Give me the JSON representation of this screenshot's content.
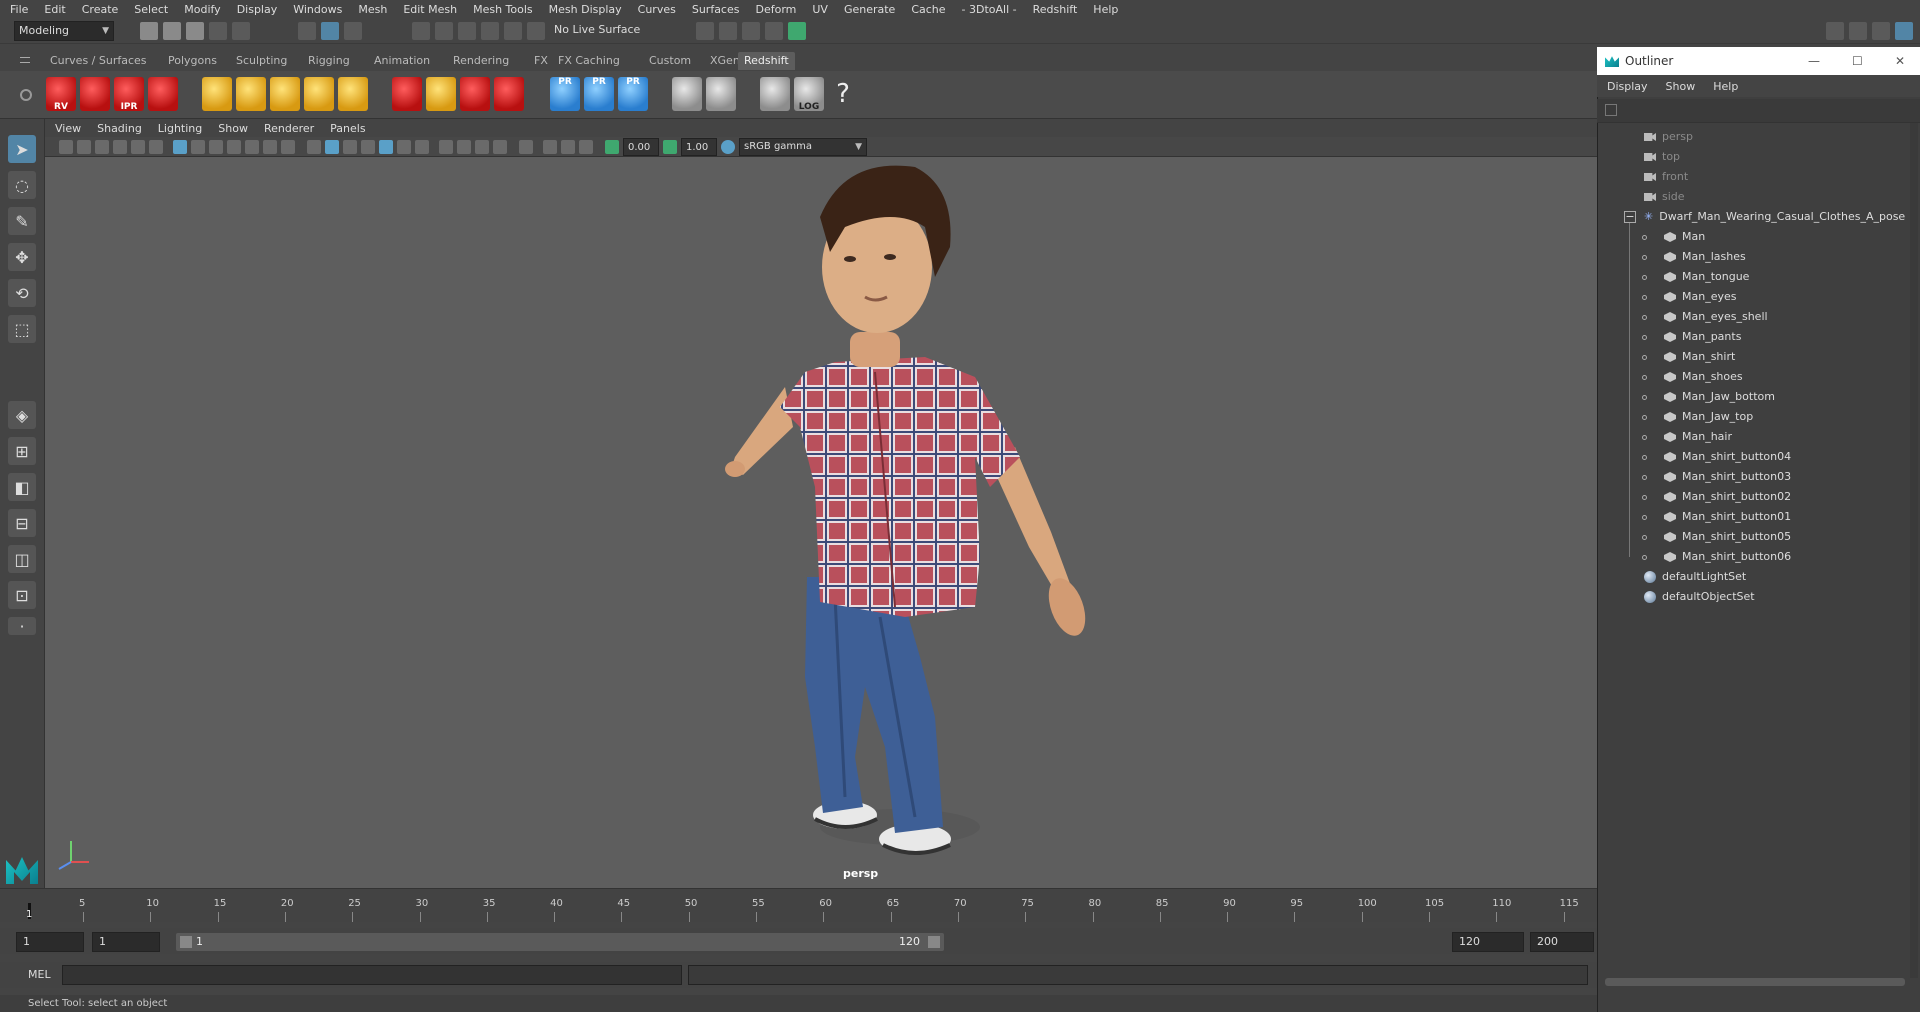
{
  "menubar": {
    "items": [
      "File",
      "Edit",
      "Create",
      "Select",
      "Modify",
      "Display",
      "Windows",
      "Mesh",
      "Edit Mesh",
      "Mesh Tools",
      "Mesh Display",
      "Curves",
      "Surfaces",
      "Deform",
      "UV",
      "Generate",
      "Cache",
      "- 3DtoAll -",
      "Redshift",
      "Help"
    ]
  },
  "statusline": {
    "mode_select": "Modeling",
    "live_surface": "No Live Surface"
  },
  "shelf": {
    "tabs": [
      "Curves / Surfaces",
      "Polygons",
      "Sculpting",
      "Rigging",
      "Animation",
      "Rendering",
      "FX",
      "FX Caching",
      "Custom",
      "XGen",
      "Redshift"
    ],
    "active_tab": "Redshift",
    "icon_labels": {
      "rv": "RV",
      "ipr": "IPR",
      "pr1": "PR",
      "pr2": "PR",
      "pr3": "PR",
      "log": "LOG",
      "help": "?"
    }
  },
  "viewport": {
    "menu": [
      "View",
      "Shading",
      "Lighting",
      "Show",
      "Renderer",
      "Panels"
    ],
    "exposure": "0.00",
    "gamma": "1.00",
    "color_space": "sRGB gamma",
    "camera_label": "persp"
  },
  "timeline": {
    "ticks": [
      "5",
      "10",
      "15",
      "20",
      "25",
      "30",
      "35",
      "40",
      "45",
      "50",
      "55",
      "60",
      "65",
      "70",
      "75",
      "80",
      "85",
      "90",
      "95",
      "100",
      "105",
      "110",
      "115"
    ],
    "current_frame": "1",
    "range_start": "1",
    "playback_start": "1",
    "slider_start": "1",
    "slider_end": "120",
    "playback_end": "120",
    "range_end": "200"
  },
  "cmdline": {
    "label": "MEL"
  },
  "helpline": {
    "text": "Select Tool: select an object"
  },
  "outliner": {
    "title": "Outliner",
    "menu": [
      "Display",
      "Show",
      "Help"
    ],
    "cameras": [
      "persp",
      "top",
      "front",
      "side"
    ],
    "group": "Dwarf_Man_Wearing_Casual_Clothes_A_pose",
    "meshes": [
      "Man",
      "Man_lashes",
      "Man_tongue",
      "Man_eyes",
      "Man_eyes_shell",
      "Man_pants",
      "Man_shirt",
      "Man_shoes",
      "Man_Jaw_bottom",
      "Man_Jaw_top",
      "Man_hair",
      "Man_shirt_button04",
      "Man_shirt_button03",
      "Man_shirt_button02",
      "Man_shirt_button01",
      "Man_shirt_button05",
      "Man_shirt_button06"
    ],
    "sets": [
      "defaultLightSet",
      "defaultObjectSet"
    ]
  },
  "colors": {
    "accent": "#5285a6",
    "redshift_red": "#d32020",
    "ui_bg": "#444444",
    "viewport_bg": "#5e5e5e"
  }
}
